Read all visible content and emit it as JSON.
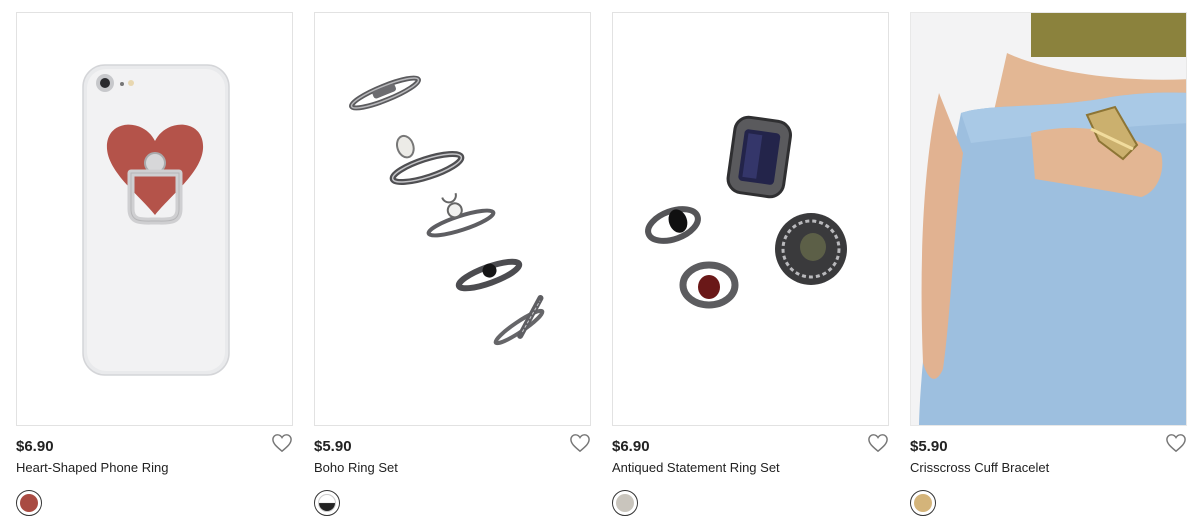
{
  "products": [
    {
      "price": "$6.90",
      "name": "Heart-Shaped Phone Ring",
      "image_alt": "phone-ring-image",
      "swatch_color": "#a94b42",
      "swatch_color_bottom": "#a94b42"
    },
    {
      "price": "$5.90",
      "name": "Boho Ring Set",
      "image_alt": "ring-set-image",
      "swatch_color": "#ffffff",
      "swatch_color_bottom": "#222222"
    },
    {
      "price": "$6.90",
      "name": "Antiqued Statement Ring Set",
      "image_alt": "statement-ring-set-image",
      "swatch_color": "#c9c5bd",
      "swatch_color_bottom": "#c9c5bd"
    },
    {
      "price": "$5.90",
      "name": "Crisscross Cuff Bracelet",
      "image_alt": "cuff-bracelet-image",
      "swatch_color": "#d4b47a",
      "swatch_color_bottom": "#d4b47a"
    }
  ],
  "icons": {
    "favorite": "heart-outline-icon"
  }
}
